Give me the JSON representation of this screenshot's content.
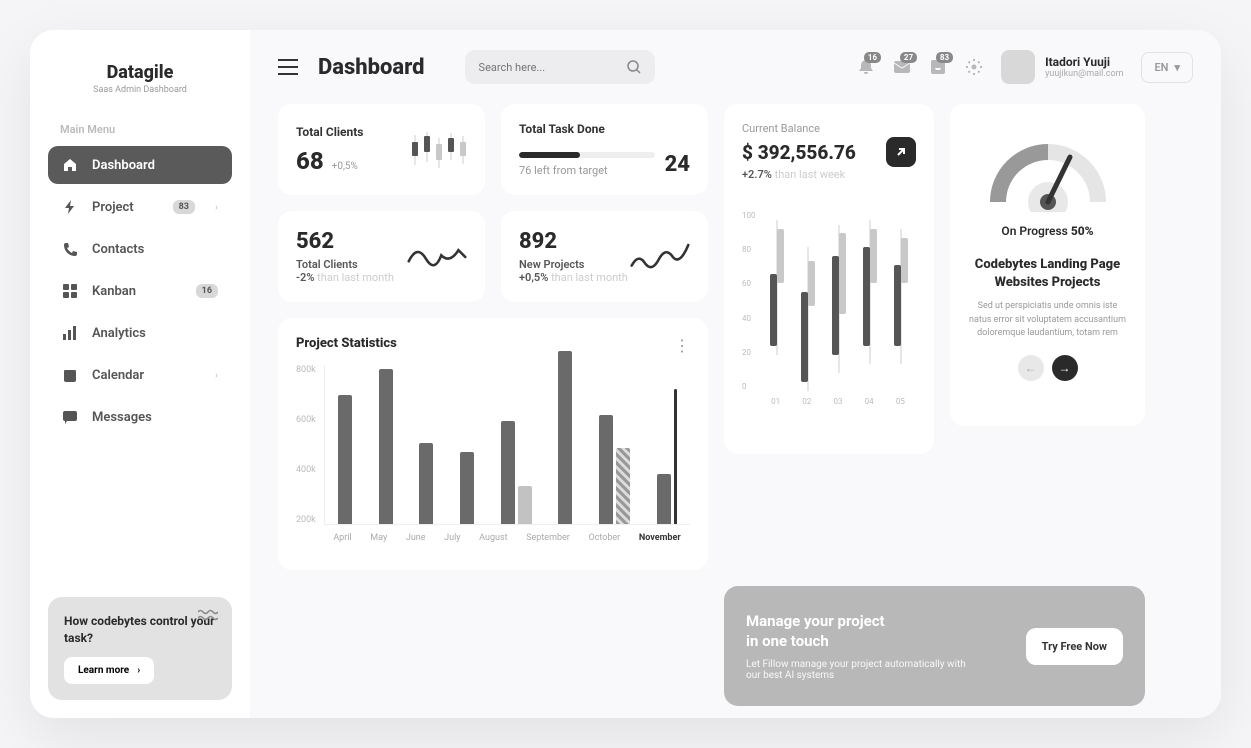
{
  "brand": {
    "title": "Datagile",
    "subtitle": "Saas Admin Dashboard"
  },
  "menu_label": "Main Menu",
  "nav": [
    {
      "label": "Dashboard",
      "icon": "home"
    },
    {
      "label": "Project",
      "icon": "bolt",
      "badge": "83",
      "chev": true
    },
    {
      "label": "Contacts",
      "icon": "phone"
    },
    {
      "label": "Kanban",
      "icon": "grid",
      "badge": "16"
    },
    {
      "label": "Analytics",
      "icon": "bars"
    },
    {
      "label": "Calendar",
      "icon": "calendar",
      "chev": true
    },
    {
      "label": "Messages",
      "icon": "chat"
    }
  ],
  "sidebar_promo": {
    "title": "How codebytes control your task?",
    "button": "Learn more"
  },
  "page_title": "Dashboard",
  "search_placeholder": "Search here...",
  "notifications": {
    "bell": "16",
    "mail": "27",
    "gift": "83"
  },
  "user": {
    "name": "Itadori Yuuji",
    "email": "yuujikun@mail.com"
  },
  "language": "EN",
  "cards": {
    "total_clients": {
      "label": "Total Clients",
      "value": "68",
      "delta": "+0,5%"
    },
    "task_done": {
      "label": "Total Task Done",
      "value": "24",
      "sub": "76 left from target",
      "pct": 45
    },
    "clients2": {
      "value": "562",
      "label": "Total Clients",
      "delta": "-2%",
      "delta_sub": "than last month"
    },
    "new_projects": {
      "value": "892",
      "label": "New Projects",
      "delta": "+0,5%",
      "delta_sub": "than last month"
    }
  },
  "chart_data": {
    "type": "bar",
    "title": "Project Statistics",
    "ylabel": "",
    "xlabel": "",
    "ylim": [
      0,
      800
    ],
    "y_ticks": [
      "800k",
      "600k",
      "400k",
      "200k"
    ],
    "categories": [
      "April",
      "May",
      "June",
      "July",
      "August",
      "September",
      "October",
      "November"
    ],
    "series": [
      {
        "name": "A",
        "values": [
          650,
          780,
          410,
          360,
          520,
          870,
          550,
          250
        ]
      },
      {
        "name": "B",
        "values": [
          null,
          null,
          null,
          null,
          190,
          null,
          380,
          680
        ]
      }
    ],
    "patterns": {
      "October_B": "hatch",
      "November_B": "line"
    },
    "active_category": "November"
  },
  "balance": {
    "label": "Current Balance",
    "value": "$ 392,556.76",
    "delta": "+2.7%",
    "delta_sub": "than last week",
    "y_ticks": [
      "100",
      "80",
      "60",
      "40",
      "20",
      "0"
    ],
    "x_ticks": [
      "01",
      "02",
      "03",
      "04",
      "05"
    ],
    "candles": [
      {
        "d_top": 35,
        "d_h": 40,
        "l_top": 10,
        "l_h": 30,
        "w_top": 5,
        "w_h": 75
      },
      {
        "d_top": 45,
        "d_h": 50,
        "l_top": 28,
        "l_h": 25,
        "w_top": 20,
        "w_h": 80
      },
      {
        "d_top": 25,
        "d_h": 55,
        "l_top": 12,
        "l_h": 45,
        "w_top": 8,
        "w_h": 82
      },
      {
        "d_top": 20,
        "d_h": 55,
        "l_top": 10,
        "l_h": 30,
        "w_top": 5,
        "w_h": 80
      },
      {
        "d_top": 30,
        "d_h": 45,
        "l_top": 15,
        "l_h": 25,
        "w_top": 10,
        "w_h": 75
      }
    ]
  },
  "promo2": {
    "title1": "Manage your project",
    "title2": "in one touch",
    "sub": "Let Fillow manage your project automatically with our best AI systems",
    "button": "Try Free Now"
  },
  "gauge": {
    "pct": 50,
    "label_prefix": "On Progress ",
    "label_value": "50%",
    "title": "Codebytes Landing Page Websites Projects",
    "desc": "Sed ut perspiciatis unde omnis iste natus error sit voluptatem accusantium doloremque laudantium, totam rem"
  }
}
